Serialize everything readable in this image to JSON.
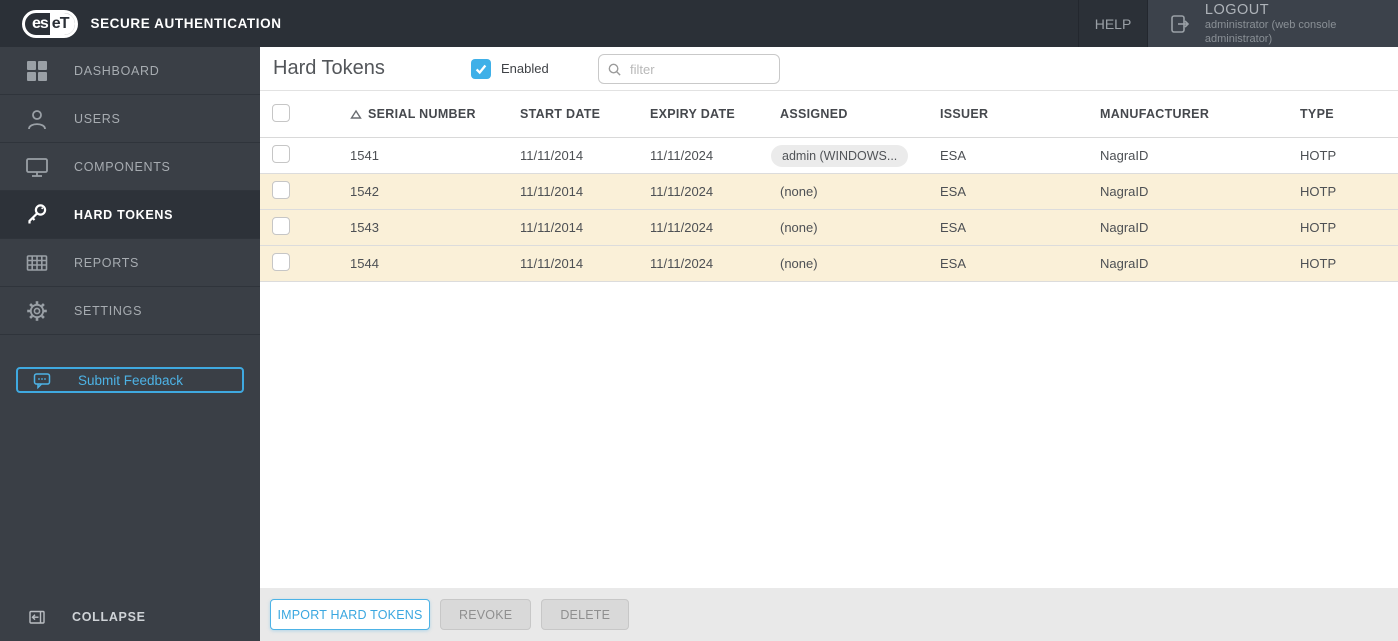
{
  "topbar": {
    "brand": {
      "logo_left": "es",
      "logo_right": "eT",
      "product": "SECURE AUTHENTICATION"
    },
    "help_label": "HELP",
    "logout": {
      "label": "LOGOUT",
      "subtitle": "administrator (web console administrator)"
    }
  },
  "sidebar": {
    "items": [
      {
        "label": "DASHBOARD",
        "icon": "dashboard-grid-icon",
        "active": false
      },
      {
        "label": "USERS",
        "icon": "user-icon",
        "active": false
      },
      {
        "label": "COMPONENTS",
        "icon": "monitor-icon",
        "active": false
      },
      {
        "label": "HARD TOKENS",
        "icon": "key-icon",
        "active": true
      },
      {
        "label": "REPORTS",
        "icon": "report-table-icon",
        "active": false
      },
      {
        "label": "SETTINGS",
        "icon": "gear-icon",
        "active": false
      }
    ],
    "feedback_button": "Submit Feedback",
    "collapse_label": "COLLAPSE"
  },
  "content": {
    "title": "Hard Tokens",
    "enabled_checkbox": {
      "label": "Enabled",
      "checked": true
    },
    "filter": {
      "placeholder": "filter",
      "value": ""
    }
  },
  "table": {
    "columns": [
      "SERIAL NUMBER",
      "START DATE",
      "EXPIRY DATE",
      "ASSIGNED",
      "ISSUER",
      "MANUFACTURER",
      "TYPE"
    ],
    "sort": {
      "column": "SERIAL NUMBER",
      "direction": "ascending"
    },
    "rows": [
      {
        "serial": "1541",
        "start_date": "11/11/2014",
        "expiry_date": "11/11/2024",
        "assigned": "admin (WINDOWS...",
        "assigned_is_badge": true,
        "issuer": "ESA",
        "manufacturer": "NagraID",
        "type": "HOTP",
        "highlighted": false
      },
      {
        "serial": "1542",
        "start_date": "11/11/2014",
        "expiry_date": "11/11/2024",
        "assigned": "(none)",
        "assigned_is_badge": false,
        "issuer": "ESA",
        "manufacturer": "NagraID",
        "type": "HOTP",
        "highlighted": true
      },
      {
        "serial": "1543",
        "start_date": "11/11/2014",
        "expiry_date": "11/11/2024",
        "assigned": "(none)",
        "assigned_is_badge": false,
        "issuer": "ESA",
        "manufacturer": "NagraID",
        "type": "HOTP",
        "highlighted": true
      },
      {
        "serial": "1544",
        "start_date": "11/11/2014",
        "expiry_date": "11/11/2024",
        "assigned": "(none)",
        "assigned_is_badge": false,
        "issuer": "ESA",
        "manufacturer": "NagraID",
        "type": "HOTP",
        "highlighted": true
      }
    ]
  },
  "footer": {
    "import_button": "IMPORT HARD TOKENS",
    "revoke_button": "REVOKE",
    "delete_button": "DELETE"
  },
  "colors": {
    "accent_blue": "#3fb0e8",
    "row_highlight": "#faf0d8",
    "topbar_bg": "#2b3037",
    "sidebar_bg": "#3a3f46",
    "active_item_bg": "#2d3239"
  }
}
